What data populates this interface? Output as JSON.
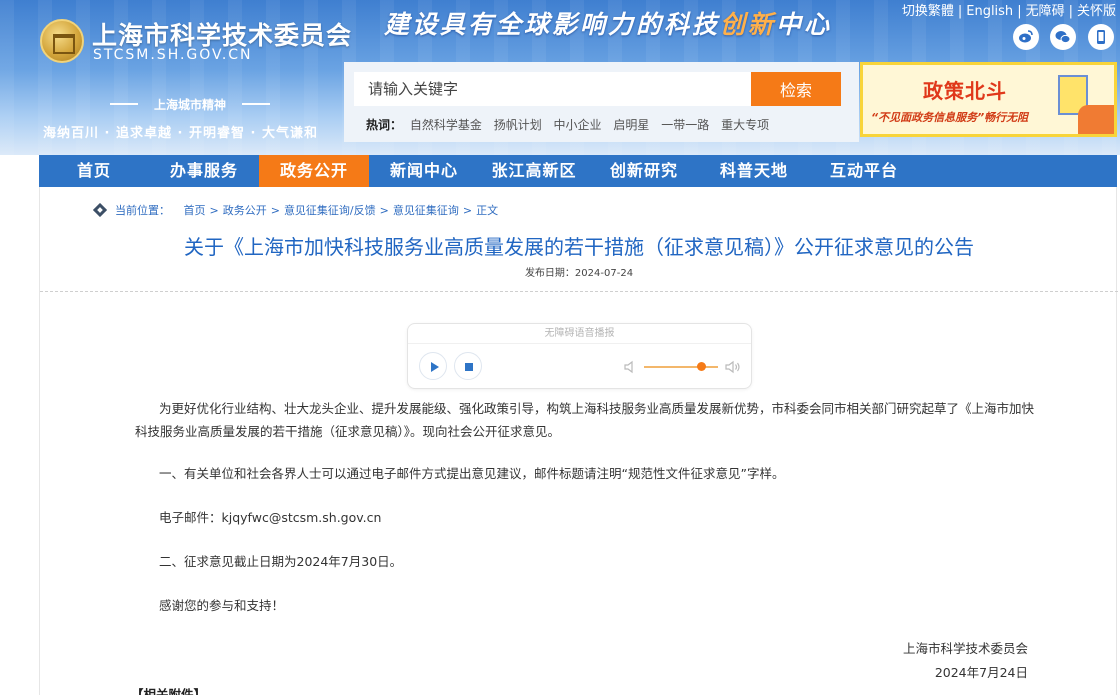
{
  "header": {
    "site_name_cn": "上海市科学技术委员会",
    "site_name_en": "STCSM.SH.GOV.CN",
    "slogan_parts": [
      "建设具有全球影响力的科技",
      "创新",
      "中心"
    ],
    "top_links": [
      "切换繁體",
      "English",
      "无障碍",
      "关怀版"
    ],
    "social_icons": [
      "weibo-icon",
      "wechat-icon",
      "mobile-icon"
    ],
    "spirit_label": "上海城市精神",
    "spirit_text": "海纳百川 · 追求卓越 · 开明睿智 · 大气谦和"
  },
  "search": {
    "placeholder": "请输入关键字",
    "button_label": "检索",
    "hot_label": "热词：",
    "hot_words": [
      "自然科学基金",
      "扬帆计划",
      "中小企业",
      "启明星",
      "一带一路",
      "重大专项"
    ]
  },
  "policy_banner": {
    "title": "政策北斗",
    "subtitle": "“不见面政务信息服务”畅行无阻"
  },
  "nav": {
    "items": [
      "首页",
      "办事服务",
      "政务公开",
      "新闻中心",
      "张江高新区",
      "创新研究",
      "科普天地",
      "互动平台"
    ],
    "active_index": 2
  },
  "breadcrumb": {
    "label": "当前位置：",
    "items": [
      "首页",
      "政务公开",
      "意见征集征询/反馈",
      "意见征集征询",
      "正文"
    ]
  },
  "article": {
    "title": "关于《上海市加快科技服务业高质量发展的若干措施（征求意见稿）》公开征求意见的公告",
    "date_label": "发布日期：2024-07-24",
    "paragraphs": [
      "为更好优化行业结构、壮大龙头企业、提升发展能级、强化政策引导，构筑上海科技服务业高质量发展新优势，市科委会同市相关部门研究起草了《上海市加快科技服务业高质量发展的若干措施（征求意见稿）》。现向社会公开征求意见。",
      "一、有关单位和社会各界人士可以通过电子邮件方式提出意见建议，邮件标题请注明“规范性文件征求意见”字样。",
      "电子邮件：kjqyfwc@stcsm.sh.gov.cn",
      "二、征求意见截止日期为2024年7月30日。",
      "感谢您的参与和支持！"
    ],
    "signature_org": "上海市科学技术委员会",
    "signature_date": "2024年7月24日",
    "attachments_label": "【相关附件】"
  },
  "audio": {
    "title": "无障碍语音播报",
    "volume": 0.8
  }
}
